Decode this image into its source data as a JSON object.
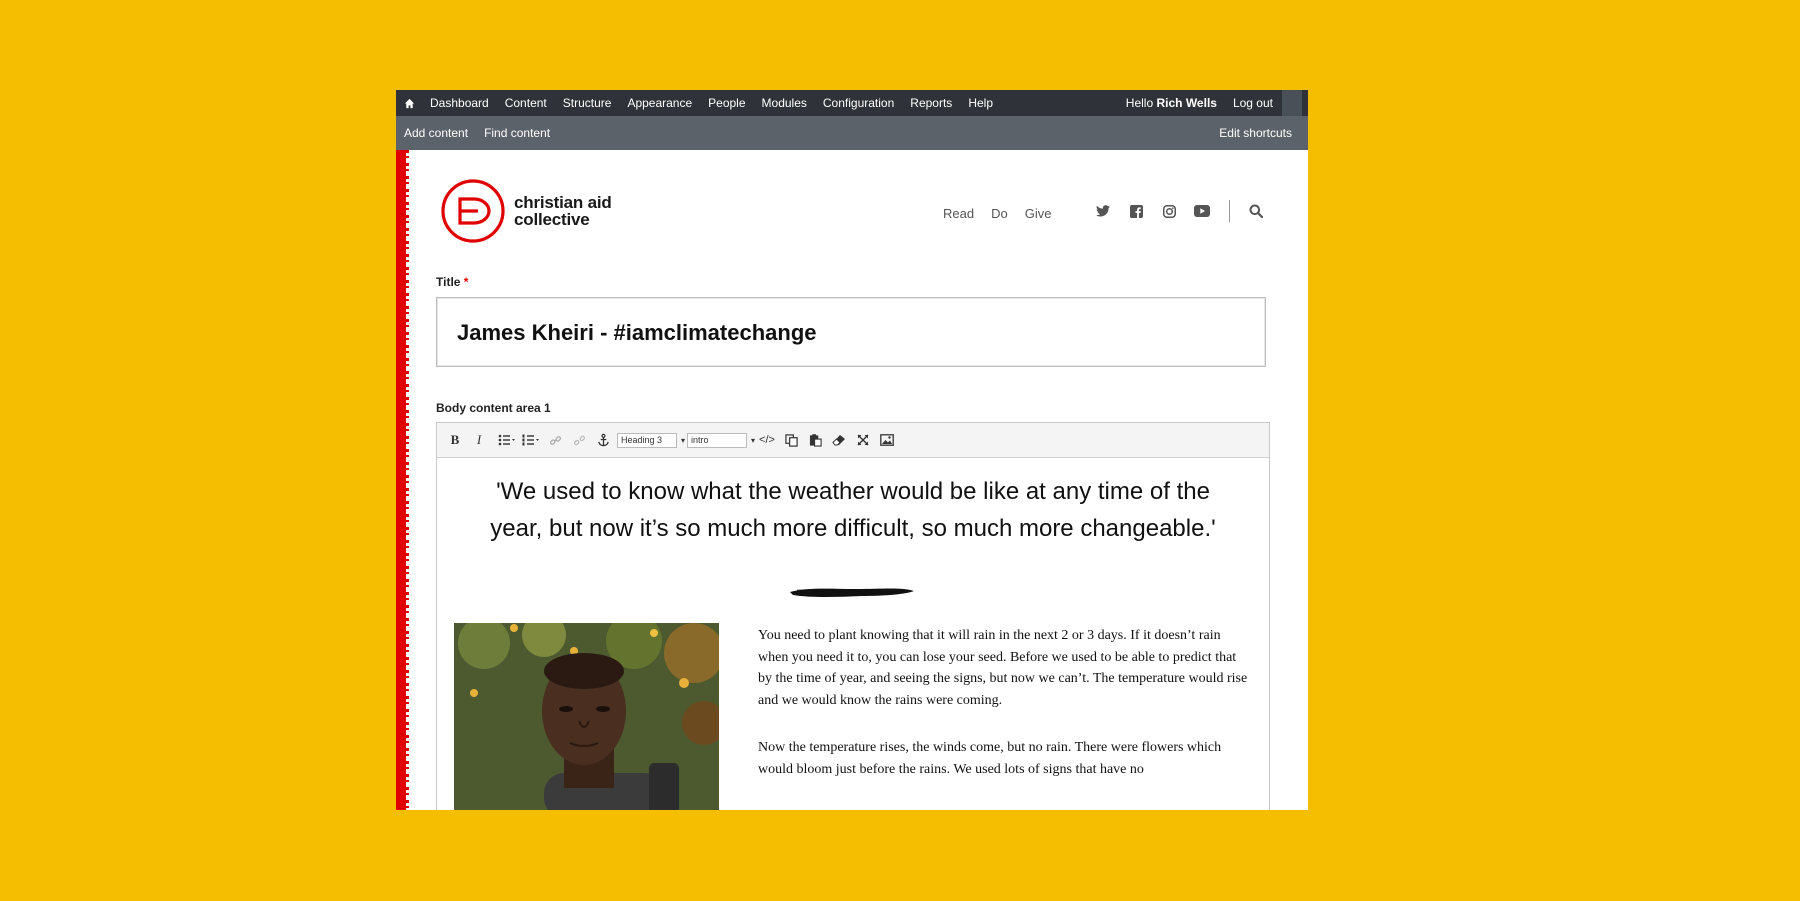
{
  "admin_toolbar": {
    "home_icon": "home-icon",
    "items": [
      {
        "label": "Dashboard"
      },
      {
        "label": "Content"
      },
      {
        "label": "Structure"
      },
      {
        "label": "Appearance"
      },
      {
        "label": "People"
      },
      {
        "label": "Modules"
      },
      {
        "label": "Configuration"
      },
      {
        "label": "Reports"
      },
      {
        "label": "Help"
      }
    ],
    "greeting": "Hello",
    "user_name": "Rich Wells",
    "logout_label": "Log out"
  },
  "shortcuts": {
    "items": [
      {
        "label": "Add content"
      },
      {
        "label": "Find content"
      }
    ],
    "edit_label": "Edit shortcuts"
  },
  "site": {
    "logo_line1": "christian aid",
    "logo_line2": "collective",
    "nav": [
      {
        "label": "Read"
      },
      {
        "label": "Do"
      },
      {
        "label": "Give"
      }
    ],
    "social_icons": [
      "twitter-icon",
      "facebook-icon",
      "instagram-icon",
      "youtube-icon"
    ],
    "search_icon": "search-icon",
    "brand_color": "#e10000"
  },
  "form": {
    "title_label": "Title",
    "required_marker": "*",
    "title_value": "James Kheiri - #iamclimatechange",
    "body_label": "Body content area 1"
  },
  "editor": {
    "toolbar": {
      "bold": "B",
      "italic": "I",
      "format_value": "Heading 3",
      "style_value": "intro",
      "icons": [
        "bold-icon",
        "italic-icon",
        "bulleted-list-icon",
        "numbered-list-icon",
        "link-icon",
        "unlink-icon",
        "anchor-icon",
        "source-icon",
        "copy-icon",
        "paste-icon",
        "remove-format-icon",
        "maximize-icon",
        "image-icon"
      ]
    },
    "quote": "'We used to know what the weather would be like at any time of the year, but now it’s so much more difficult, so much more changeable.'",
    "paragraphs": [
      "You need to plant knowing that it will rain in the next 2 or 3 days. If it doesn’t rain when you need it to, you can lose your seed. Before we used to be able to predict that by the time of year, and seeing the signs, but now we can’t. The temperature would rise and we would know the rains were coming.",
      "Now the temperature rises, the winds come, but no rain. There were flowers which would bloom just before the rains. We used lots of signs that have no"
    ]
  },
  "colors": {
    "page_background": "#F6BE00",
    "toolbar_dark": "#2f3339",
    "toolbar_shortcuts": "#5c6269"
  }
}
